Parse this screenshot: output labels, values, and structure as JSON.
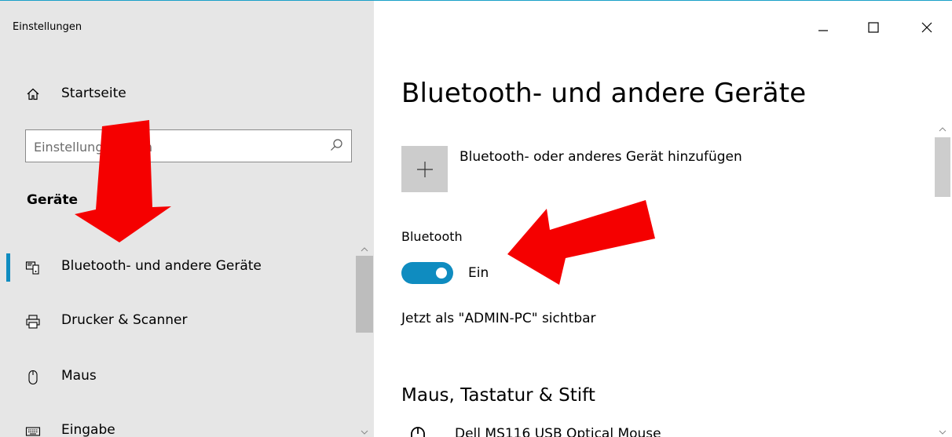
{
  "window": {
    "title": "Einstellungen"
  },
  "sidebar": {
    "home_label": "Startseite",
    "search_placeholder": "Einstellung suchen",
    "section_heading": "Geräte",
    "items": [
      {
        "label": "Bluetooth- und andere Geräte",
        "icon": "bluetooth-devices-icon",
        "active": true
      },
      {
        "label": "Drucker & Scanner",
        "icon": "printer-icon",
        "active": false
      },
      {
        "label": "Maus",
        "icon": "mouse-icon",
        "active": false
      },
      {
        "label": "Eingabe",
        "icon": "keyboard-icon",
        "active": false
      }
    ]
  },
  "main": {
    "title": "Bluetooth- und andere Geräte",
    "add_device_label": "Bluetooth- oder anderes Gerät hinzufügen",
    "bluetooth_heading": "Bluetooth",
    "bluetooth_toggle_state": "Ein",
    "bluetooth_on": true,
    "visible_as": "Jetzt als \"ADMIN-PC\" sichtbar",
    "section_mouse_keyboard": "Maus, Tastatur & Stift",
    "devices": [
      {
        "name": "Dell MS116 USB Optical Mouse",
        "icon": "mouse-icon"
      }
    ]
  },
  "colors": {
    "accent": "#0f8cc0",
    "sidebar_bg": "#e6e6e6",
    "annotation_arrow": "#ff0000"
  }
}
